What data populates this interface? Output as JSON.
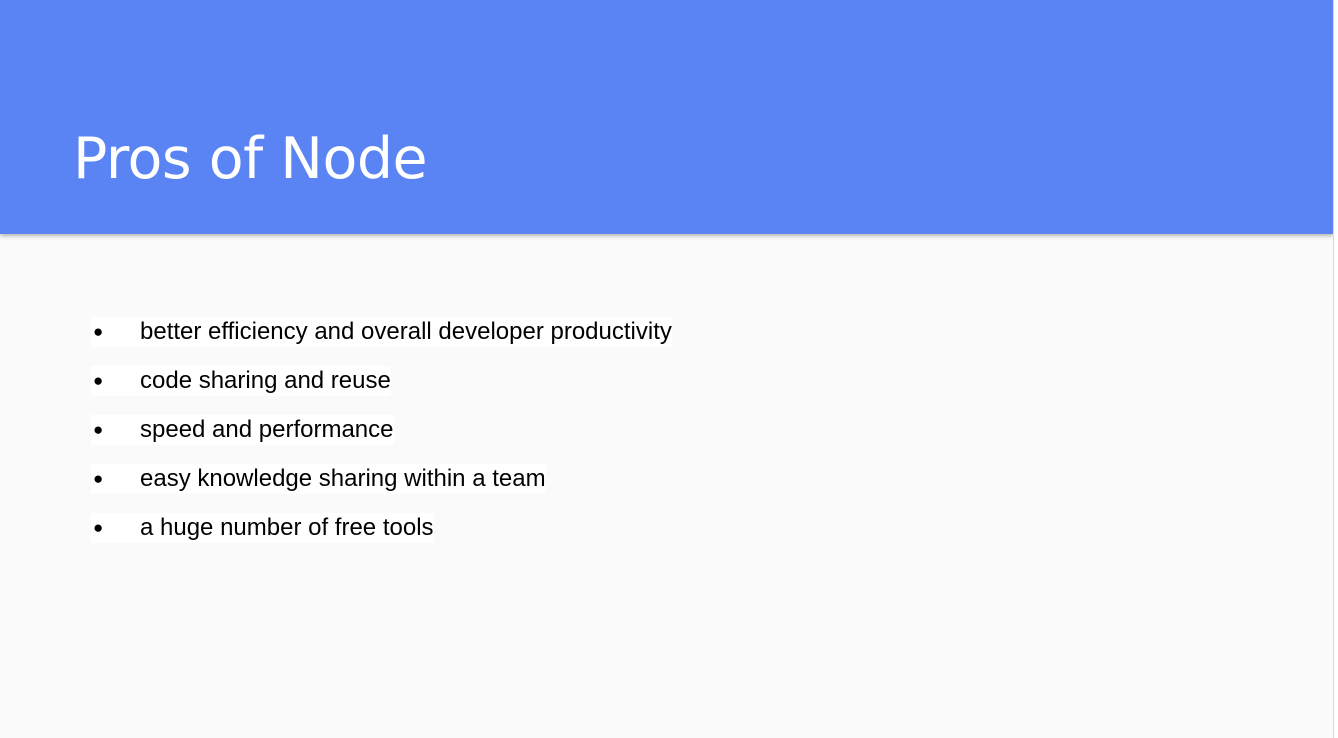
{
  "slide": {
    "title": "Pros of Node",
    "bullet_glyph": "●",
    "bullets": [
      "better efficiency and overall developer productivity",
      "code sharing and reuse",
      "speed and performance",
      "easy knowledge sharing within a team",
      "a huge number of free tools"
    ]
  },
  "colors": {
    "header": "#5a83f4",
    "background": "#fafafa",
    "text_highlight": "#ffffff"
  }
}
